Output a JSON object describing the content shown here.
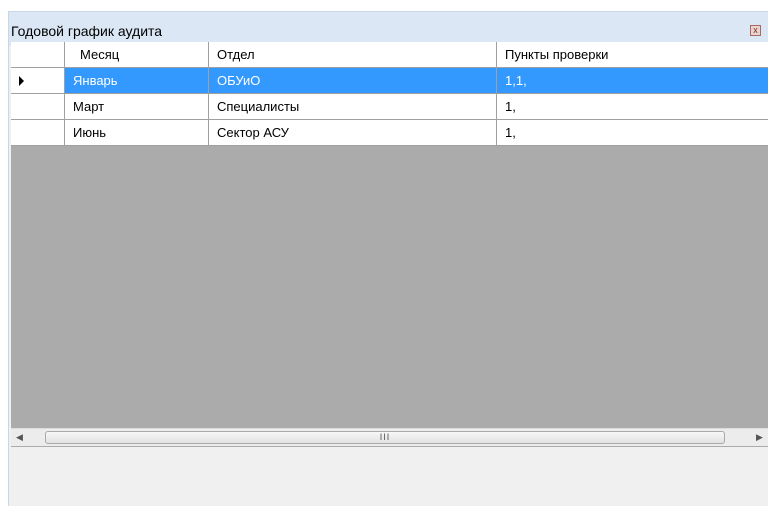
{
  "window": {
    "title": "Годовой график аудита",
    "close_icon": "close-icon"
  },
  "grid": {
    "columns": [
      "Месяц",
      "Отдел",
      "Пункты проверки"
    ],
    "rows": [
      {
        "month": "Январь",
        "department": "ОБУиО",
        "points": "1,1,",
        "selected": true
      },
      {
        "month": "Март",
        "department": "Специалисты",
        "points": "1,"
      },
      {
        "month": "Июнь",
        "department": "Сектор АСУ",
        "points": "1,"
      }
    ]
  },
  "scrollbar": {
    "left_icon": "arrow-left-icon",
    "right_icon": "arrow-right-icon",
    "thumb_grip": "III"
  },
  "colors": {
    "selection": "#3399ff",
    "empty_area": "#ababab",
    "titlebar": "#dce7f5"
  }
}
